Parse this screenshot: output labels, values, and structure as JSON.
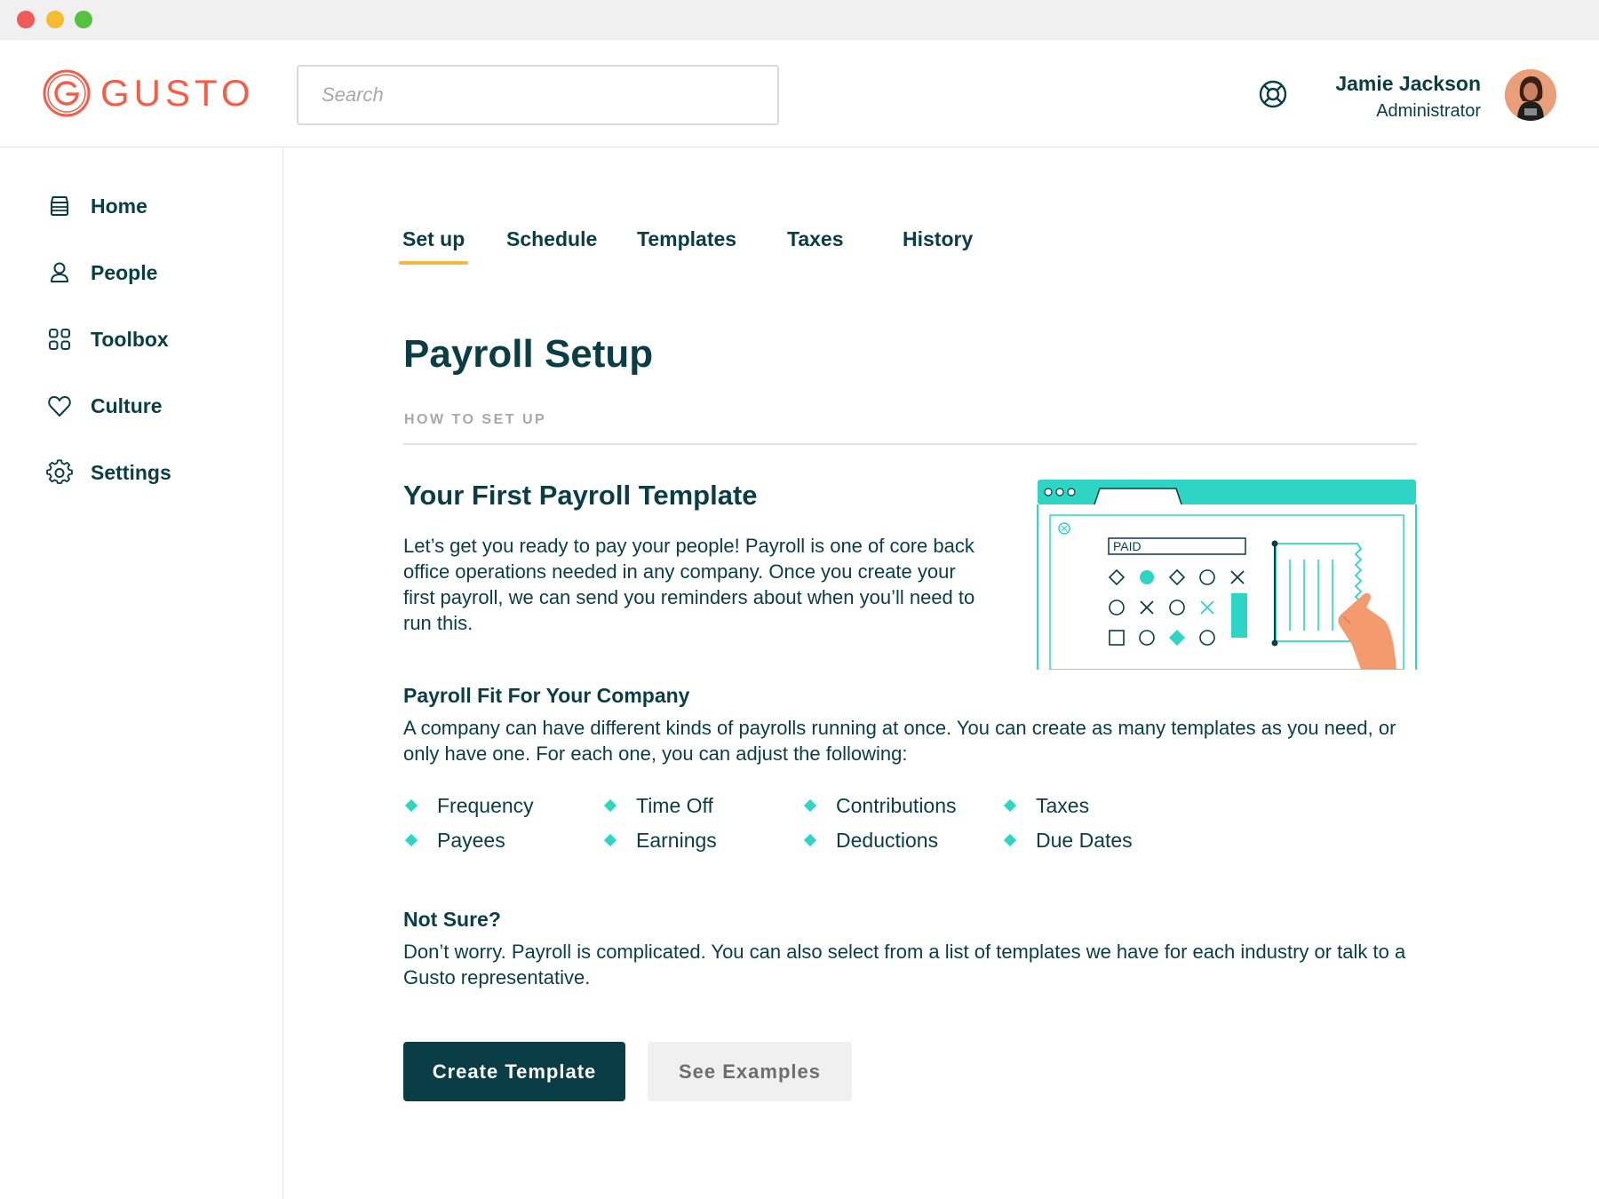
{
  "window": {
    "controls": [
      "close",
      "minimize",
      "maximize"
    ]
  },
  "brand": {
    "name": "GUSTO",
    "logo_icon": "gusto-g-logo",
    "color": "#f45d48"
  },
  "search": {
    "placeholder": "Search",
    "value": ""
  },
  "header": {
    "help_icon": "lifebuoy-icon"
  },
  "user": {
    "name": "Jamie Jackson",
    "role": "Administrator"
  },
  "sidebar": {
    "items": [
      {
        "label": "Home",
        "icon": "home-icon"
      },
      {
        "label": "People",
        "icon": "person-icon"
      },
      {
        "label": "Toolbox",
        "icon": "grid-icon"
      },
      {
        "label": "Culture",
        "icon": "heart-icon"
      },
      {
        "label": "Settings",
        "icon": "gear-icon"
      }
    ]
  },
  "tabs": [
    {
      "label": "Set up",
      "active": true
    },
    {
      "label": "Schedule",
      "active": false
    },
    {
      "label": "Templates",
      "active": false
    },
    {
      "label": "Taxes",
      "active": false
    },
    {
      "label": "History",
      "active": false
    }
  ],
  "main": {
    "title": "Payroll Setup",
    "eyebrow": "HOW TO SET UP",
    "section_title": "Your First Payroll Template",
    "intro": "Let’s get you ready to pay your people! Payroll is one of core back office operations needed in any company. Once you create your first payroll, we can send you reminders about when you’ll need to run this.",
    "illustration": {
      "stamp_text": "PAID"
    },
    "fit_title": "Payroll Fit For Your Company",
    "fit_text": "A company can have different kinds of payrolls running at once. You can create as many templates as you need, or only have one. For each one, you can adjust the following:",
    "features": [
      [
        "Frequency",
        "Payees"
      ],
      [
        "Time Off",
        "Earnings"
      ],
      [
        "Contributions",
        "Deductions"
      ],
      [
        "Taxes",
        "Due Dates"
      ]
    ],
    "not_sure_title": "Not Sure?",
    "not_sure_text": "Don’t worry. Payroll is complicated. You can also select from a list of templates we have for each industry or talk to a Gusto representative.",
    "primary_button": "Create Template",
    "secondary_button": "See Examples"
  },
  "colors": {
    "ink": "#0a3d45",
    "accent_teal": "#2ed5c4",
    "tab_underline": "#f4b73f",
    "brand_red": "#f45d48",
    "muted": "#a8a8a8"
  }
}
